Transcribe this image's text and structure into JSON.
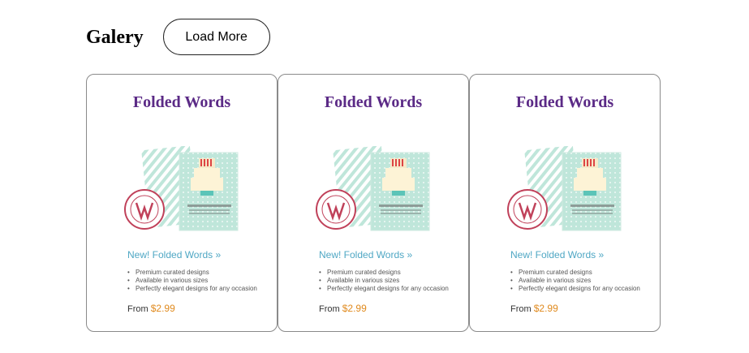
{
  "header": {
    "title": "Galery",
    "load_more_label": "Load More"
  },
  "cards": [
    {
      "title": "Folded Words",
      "image": {
        "alt": "Folded Words birthday card",
        "icon": "card-product-image"
      },
      "link_label": "New! Folded Words »",
      "features": [
        "Premium curated designs",
        "Available in various sizes",
        "Perfectly elegant designs for any occasion"
      ],
      "price_prefix": "From",
      "price": "$2.99"
    },
    {
      "title": "Folded Words",
      "image": {
        "alt": "Folded Words birthday card",
        "icon": "card-product-image"
      },
      "link_label": "New! Folded Words »",
      "features": [
        "Premium curated designs",
        "Available in various sizes",
        "Perfectly elegant designs for any occasion"
      ],
      "price_prefix": "From",
      "price": "$2.99"
    },
    {
      "title": "Folded Words",
      "image": {
        "alt": "Folded Words birthday card",
        "icon": "card-product-image"
      },
      "link_label": "New! Folded Words »",
      "features": [
        "Premium curated designs",
        "Available in various sizes",
        "Perfectly elegant designs for any occasion"
      ],
      "price_prefix": "From",
      "price": "$2.99"
    }
  ],
  "colors": {
    "card_title": "#5b2a86",
    "link": "#4fa7c4",
    "price": "#e08a1e",
    "card_border": "#8a8a8a",
    "mint": "#bfe6da",
    "stamp": "#c0415a"
  }
}
